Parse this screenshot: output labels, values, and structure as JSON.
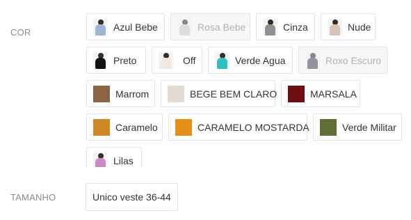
{
  "labels": {
    "color": "COR",
    "size": "TAMANHO"
  },
  "colors": [
    {
      "label": "Azul Bebe",
      "icon": "model-photo-icon",
      "body_color": "#9fb3d3",
      "disabled": false
    },
    {
      "label": "Rosa Bebe",
      "icon": "model-photo-icon",
      "body_color": "#c9c9c9",
      "disabled": true
    },
    {
      "label": "Cinza",
      "icon": "model-photo-icon",
      "body_color": "#8f8f95",
      "disabled": false
    },
    {
      "label": "Nude",
      "icon": "model-photo-icon",
      "body_color": "#d7c2b4",
      "disabled": false
    },
    {
      "label": "Preto",
      "icon": "model-photo-icon",
      "body_color": "#111111",
      "disabled": false
    },
    {
      "label": "Off",
      "icon": "model-photo-icon",
      "body_color": "#efe9e0",
      "disabled": false
    },
    {
      "label": "Verde Agua",
      "icon": "model-photo-icon",
      "body_color": "#2fc0bf",
      "disabled": false
    },
    {
      "label": "Roxo Escuro",
      "icon": "model-photo-icon",
      "body_color": "#4a3f55",
      "disabled": true
    },
    {
      "label": "Marrom",
      "swatch": "#8b6444",
      "disabled": false
    },
    {
      "label": "BEGE BEM CLARO",
      "swatch": "#e5dbd3",
      "disabled": false
    },
    {
      "label": "MARSALA",
      "swatch": "#6e0e13",
      "disabled": false
    },
    {
      "label": "Caramelo",
      "swatch": "#cd8a27",
      "disabled": false
    },
    {
      "label": "CARAMELO MOSTARDA",
      "swatch": "#e6901a",
      "disabled": false
    },
    {
      "label": "Verde Militar",
      "swatch": "#5e6e36",
      "disabled": false
    },
    {
      "label": "Lilas",
      "icon": "model-photo-icon",
      "body_color": "#c98bc6",
      "disabled": false
    }
  ],
  "sizes": [
    {
      "label": "Unico veste 36-44"
    }
  ]
}
